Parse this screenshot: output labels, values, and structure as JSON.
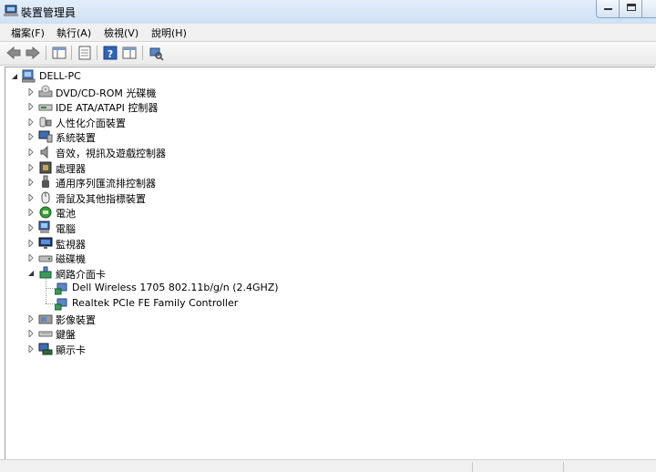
{
  "window": {
    "title": "裝置管理員"
  },
  "menu": [
    "檔案(F)",
    "執行(A)",
    "檢視(V)",
    "說明(H)"
  ],
  "toolbar": [
    "back-icon",
    "forward-icon",
    "properties-pane-icon",
    "list-icon",
    "help-icon",
    "details-icon",
    "scan-hardware-icon"
  ],
  "tree": {
    "root": "DELL-PC",
    "categories": [
      {
        "label": "DVD/CD-ROM 光碟機",
        "icon": "dvd-drive-icon",
        "expanded": false
      },
      {
        "label": "IDE ATA/ATAPI 控制器",
        "icon": "ide-controller-icon",
        "expanded": false
      },
      {
        "label": "人性化介面裝置",
        "icon": "hid-icon",
        "expanded": false
      },
      {
        "label": "系統裝置",
        "icon": "system-device-icon",
        "expanded": false
      },
      {
        "label": "音效，視訊及遊戲控制器",
        "icon": "speaker-icon",
        "expanded": false
      },
      {
        "label": "處理器",
        "icon": "processor-icon",
        "expanded": false
      },
      {
        "label": "通用序列匯流排控制器",
        "icon": "usb-icon",
        "expanded": false
      },
      {
        "label": "滑鼠及其他指標裝置",
        "icon": "mouse-icon",
        "expanded": false
      },
      {
        "label": "電池",
        "icon": "battery-icon",
        "expanded": false
      },
      {
        "label": "電腦",
        "icon": "computer-icon",
        "expanded": false
      },
      {
        "label": "監視器",
        "icon": "monitor-icon",
        "expanded": false
      },
      {
        "label": "磁碟機",
        "icon": "disk-drive-icon",
        "expanded": false
      },
      {
        "label": "網路介面卡",
        "icon": "network-adapter-icon",
        "expanded": true,
        "children": [
          "Dell Wireless 1705 802.11b/g/n (2.4GHZ)",
          "Realtek PCIe FE Family Controller"
        ]
      },
      {
        "label": "影像裝置",
        "icon": "imaging-device-icon",
        "expanded": false
      },
      {
        "label": "鍵盤",
        "icon": "keyboard-icon",
        "expanded": false
      },
      {
        "label": "顯示卡",
        "icon": "display-adapter-icon",
        "expanded": false
      }
    ]
  }
}
